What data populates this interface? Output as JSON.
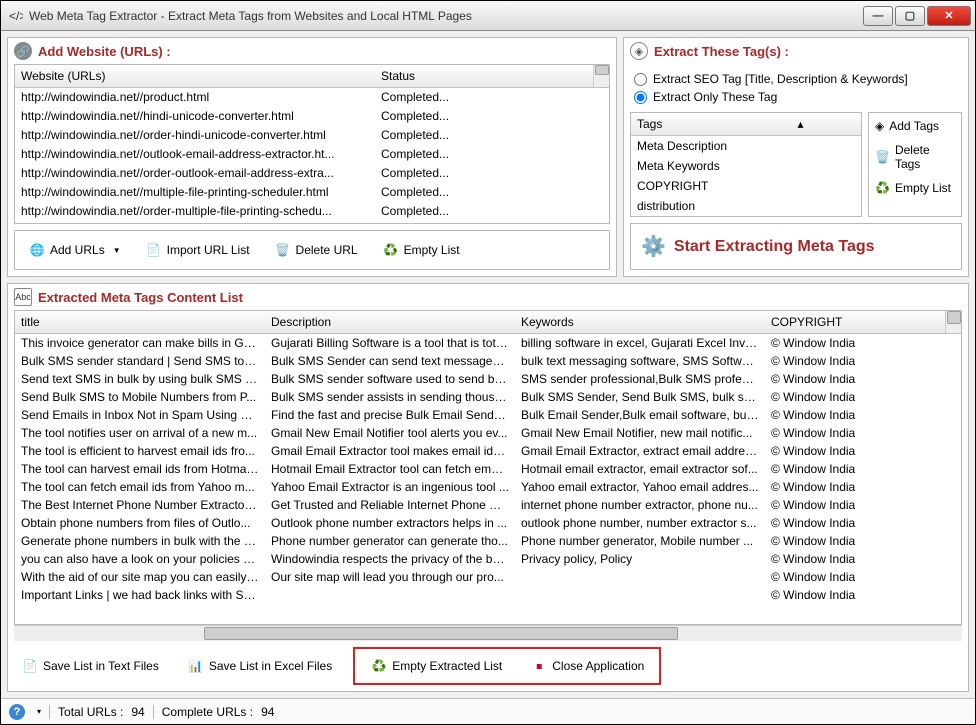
{
  "window": {
    "title": "Web Meta Tag Extractor - Extract Meta Tags from Websites and Local HTML Pages"
  },
  "panels": {
    "urls_header": "Add Website (URLs) :",
    "tags_header": "Extract These Tag(s) :",
    "extracted_header": "Extracted Meta Tags Content List"
  },
  "url_columns": {
    "c1": "Website (URLs)",
    "c2": "Status"
  },
  "urls": [
    {
      "u": "http://windowindia.net//product.html",
      "s": "Completed..."
    },
    {
      "u": "http://windowindia.net//hindi-unicode-converter.html",
      "s": "Completed..."
    },
    {
      "u": "http://windowindia.net//order-hindi-unicode-converter.html",
      "s": "Completed..."
    },
    {
      "u": "http://windowindia.net//outlook-email-address-extractor.ht...",
      "s": "Completed..."
    },
    {
      "u": "http://windowindia.net//order-outlook-email-address-extra...",
      "s": "Completed..."
    },
    {
      "u": "http://windowindia.net//multiple-file-printing-scheduler.html",
      "s": "Completed..."
    },
    {
      "u": "http://windowindia.net//order-multiple-file-printing-schedu...",
      "s": "Completed..."
    }
  ],
  "url_toolbar": {
    "add": "Add URLs",
    "import": "Import URL List",
    "delete": "Delete URL",
    "empty": "Empty List"
  },
  "radio": {
    "seo": "Extract SEO Tag [Title, Description & Keywords]",
    "only": "Extract Only These Tag"
  },
  "tags_column": "Tags",
  "tags": [
    "Meta Description",
    "Meta Keywords",
    "COPYRIGHT",
    "distribution"
  ],
  "tag_buttons": {
    "add": "Add Tags",
    "delete": "Delete Tags",
    "empty": "Empty List"
  },
  "start_label": "Start Extracting Meta Tags",
  "ext_columns": {
    "title": "title",
    "desc": "Description",
    "key": "Keywords",
    "cop": "COPYRIGHT"
  },
  "ext_rows": [
    {
      "t": "This invoice generator can make bills in Guj...",
      "d": "Gujarati Billing Software is a tool that is tota...",
      "k": "billing software in excel, Gujarati Excel Invoi...",
      "c": "©   Window India"
    },
    {
      "t": "Bulk SMS sender standard | Send SMS to m...",
      "d": "Bulk SMS Sender can send text messages in ...",
      "k": "bulk text messaging software, SMS Softwar...",
      "c": "©   Window India"
    },
    {
      "t": "Send text SMS in bulk by using bulk SMS se...",
      "d": "Bulk SMS sender software used to send bul...",
      "k": "SMS sender professional,Bulk SMS professi...",
      "c": "©   Window India"
    },
    {
      "t": "Send Bulk SMS to Mobile Numbers from P...",
      "d": "Bulk SMS sender assists in sending thousan...",
      "k": "Bulk SMS Sender, Send Bulk SMS, bulk sms,...",
      "c": "©   Window India"
    },
    {
      "t": "Send Emails in Inbox Not in Spam Using Bu...",
      "d": "Find the fast and precise Bulk Email Sender ...",
      "k": "Bulk Email Sender,Bulk email software, bulk...",
      "c": "©   Window India"
    },
    {
      "t": "The tool notifies user on arrival of a new m...",
      "d": "Gmail New Email Notifier tool alerts you ev...",
      "k": "Gmail New Email Notifier, new mail notific...",
      "c": "©   Window India"
    },
    {
      "t": "The tool is efficient to harvest email ids fro...",
      "d": "Gmail Email Extractor tool makes email ids ...",
      "k": "Gmail Email Extractor, extract email address...",
      "c": "©   Window India"
    },
    {
      "t": "The tool can harvest email ids from Hotmai...",
      "d": "Hotmail Email Extractor tool can fetch emai...",
      "k": "Hotmail email extractor, email extractor sof...",
      "c": "©   Window India"
    },
    {
      "t": "The tool can fetch email ids from Yahoo m...",
      "d": "Yahoo Email Extractor is an ingenious tool ...",
      "k": "Yahoo email extractor, Yahoo email addres...",
      "c": "©   Window India"
    },
    {
      "t": "The Best Internet Phone Number Extractor ...",
      "d": "Get Trusted and Reliable Internet Phone Nu...",
      "k": "internet phone number extractor, phone nu...",
      "c": "©   Window India"
    },
    {
      "t": "Obtain phone numbers from files of Outlo...",
      "d": "Outlook phone number extractors helps in ...",
      "k": "outlook phone number, number extractor s...",
      "c": "©   Window India"
    },
    {
      "t": "Generate phone numbers in bulk with the P...",
      "d": "Phone number generator can generate tho...",
      "k": "Phone number generator, Mobile number ...",
      "c": "©   Window India"
    },
    {
      "t": "you can also have a look on your policies a...",
      "d": "Windowindia respects the privacy of the bu...",
      "k": "Privacy policy, Policy",
      "c": "©   Window India"
    },
    {
      "t": "With the aid of our site map you can easily ...",
      "d": "Our site map will lead you through our pro...",
      "k": "",
      "c": "©   Window India"
    },
    {
      "t": "Important Links | we had back links with So...",
      "d": "",
      "k": "",
      "c": "©   Window India"
    }
  ],
  "bottom": {
    "save_txt": "Save List in Text Files",
    "save_xls": "Save List in Excel Files",
    "empty": "Empty Extracted List",
    "close": "Close Application"
  },
  "status": {
    "total_lbl": "Total URLs :",
    "total_val": "94",
    "complete_lbl": "Complete URLs :",
    "complete_val": "94"
  }
}
